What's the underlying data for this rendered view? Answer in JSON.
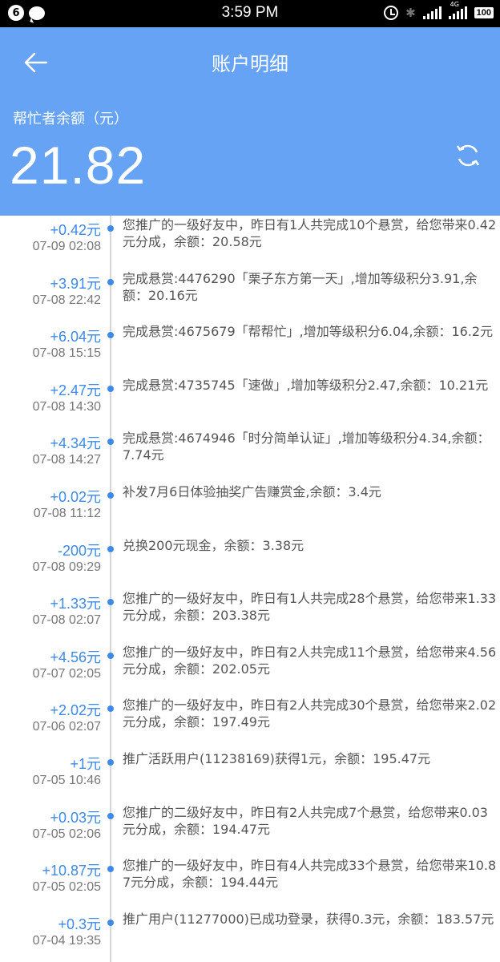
{
  "status_bar": {
    "notification_count": "6",
    "time": "3:59 PM",
    "network": "4G",
    "battery": "100"
  },
  "header": {
    "title": "账户明细",
    "balance_label": "帮忙者余额（元）",
    "balance_value": "21.82",
    "background_color": "#66a3f5"
  },
  "records": [
    {
      "amount": "+0.42元",
      "date": "07-09 02:08",
      "desc": "您推广的一级好友中，昨日有1人共完成10个悬赏，给您带来0.42元分成，余额：20.58元"
    },
    {
      "amount": "+3.91元",
      "date": "07-08 22:42",
      "desc": "完成悬赏:4476290「栗子东方第一天」,增加等级积分3.91,余额：20.16元"
    },
    {
      "amount": "+6.04元",
      "date": "07-08 15:15",
      "desc": "完成悬赏:4675679「帮帮忙」,增加等级积分6.04,余额：16.2元"
    },
    {
      "amount": "+2.47元",
      "date": "07-08 14:30",
      "desc": "完成悬赏:4735745「速做」,增加等级积分2.47,余额：10.21元"
    },
    {
      "amount": "+4.34元",
      "date": "07-08 14:27",
      "desc": "完成悬赏:4674946「时分简单认证」,增加等级积分4.34,余额：7.74元"
    },
    {
      "amount": "+0.02元",
      "date": "07-08 11:12",
      "desc": "补发7月6日体验抽奖广告赚赏金,余额：3.4元"
    },
    {
      "amount": "-200元",
      "date": "07-08 09:29",
      "desc": "兑换200元现金，余额：3.38元"
    },
    {
      "amount": "+1.33元",
      "date": "07-08 02:07",
      "desc": "您推广的一级好友中，昨日有1人共完成28个悬赏，给您带来1.33元分成，余额：203.38元"
    },
    {
      "amount": "+4.56元",
      "date": "07-07 02:05",
      "desc": "您推广的一级好友中，昨日有2人共完成11个悬赏，给您带来4.56元分成，余额：202.05元"
    },
    {
      "amount": "+2.02元",
      "date": "07-06 02:07",
      "desc": "您推广的一级好友中，昨日有2人共完成30个悬赏，给您带来2.02元分成，余额：197.49元"
    },
    {
      "amount": "+1元",
      "date": "07-05 10:46",
      "desc": "推广活跃用户(11238169)获得1元，余额：195.47元"
    },
    {
      "amount": "+0.03元",
      "date": "07-05 02:06",
      "desc": "您推广的二级好友中，昨日有2人共完成7个悬赏，给您带来0.03元分成，余额：194.47元"
    },
    {
      "amount": "+10.87元",
      "date": "07-05 02:05",
      "desc": "您推广的一级好友中，昨日有4人共完成33个悬赏，给您带来10.87元分成，余额：194.44元"
    },
    {
      "amount": "+0.3元",
      "date": "07-04 19:35",
      "desc": "推广用户(11277000)已成功登录，获得0.3元，余额：183.57元"
    }
  ]
}
